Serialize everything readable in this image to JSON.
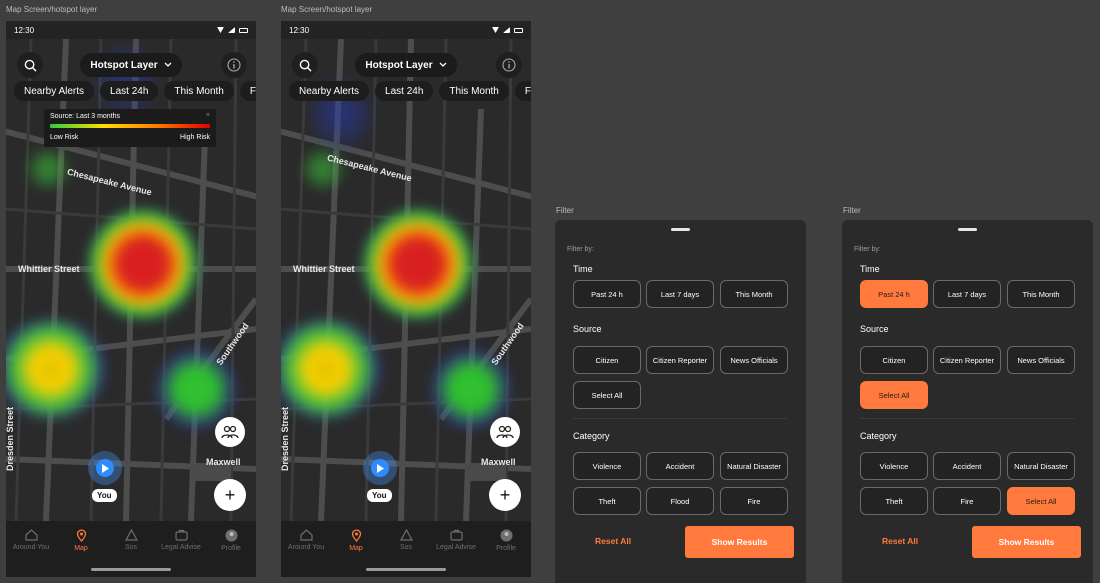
{
  "frames": [
    {
      "label": "Map Screen/hotspot layer"
    },
    {
      "label": "Map Screen/hotspot layer"
    },
    {
      "label": "Filter"
    },
    {
      "label": "Filter"
    }
  ],
  "status": {
    "time": "12:30"
  },
  "map": {
    "layer_label": "Hotspot Layer",
    "chips": [
      "Nearby Alerts",
      "Last 24h",
      "This Month",
      "F"
    ],
    "legend": {
      "source": "Source: Last 3 months",
      "low": "Low Risk",
      "high": "High Risk",
      "close": "×"
    },
    "streets": {
      "chesapeake": "Chesapeake Avenue",
      "whittier": "Whittier Street",
      "southwood": "Southwood",
      "dresden": "Dresden Street",
      "maxwell": "Maxwell"
    },
    "you_label": "You",
    "add_symbol": "+"
  },
  "nav": [
    {
      "label": "Around You",
      "icon": "home-icon"
    },
    {
      "label": "Map",
      "icon": "map-pin-icon"
    },
    {
      "label": "Sos",
      "icon": "warning-icon"
    },
    {
      "label": "Legal Advise",
      "icon": "briefcase-icon"
    },
    {
      "label": "Profile",
      "icon": "avatar-icon"
    }
  ],
  "filter": {
    "filter_by": "Filter by:",
    "time_title": "Time",
    "source_title": "Source",
    "category_title": "Category",
    "time_options": [
      "Past 24 h",
      "Last 7 days",
      "This Month"
    ],
    "source_options": [
      "Citizen",
      "Citizen Reporter",
      "News Officials",
      "Select All"
    ],
    "category_options_a": [
      "Violence",
      "Accident",
      "Natural Disaster",
      "Theft",
      "Flood",
      "Fire"
    ],
    "category_options_b": [
      "Violence",
      "Accident",
      "Natural Disaster",
      "Theft",
      "Fire",
      "Select All"
    ],
    "reset": "Reset All",
    "show": "Show Results"
  },
  "colors": {
    "accent": "#ff7a3c"
  }
}
